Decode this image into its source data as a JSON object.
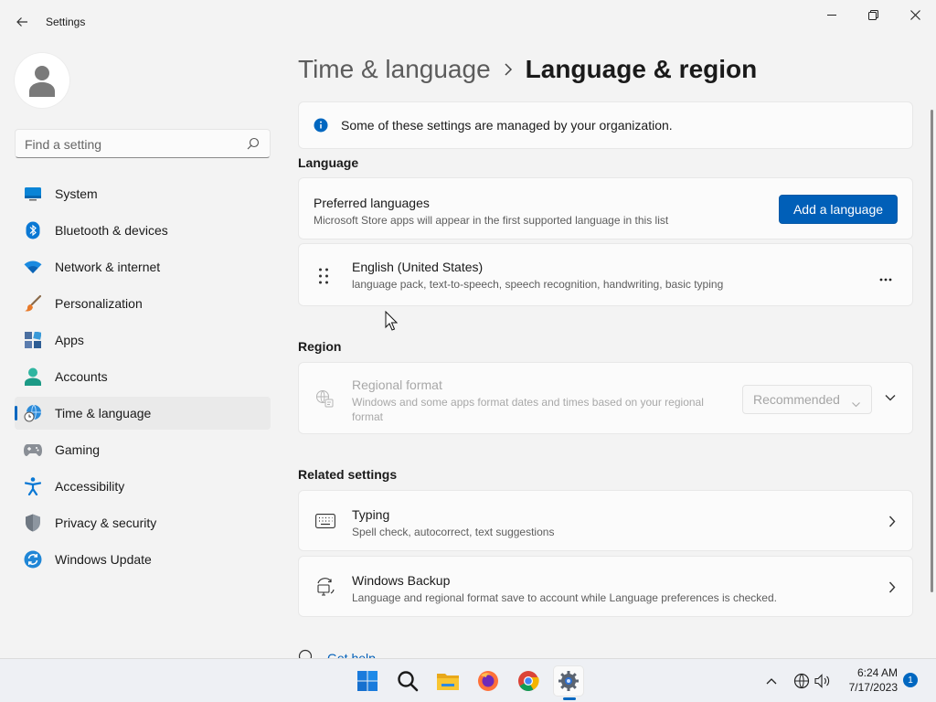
{
  "window": {
    "app_title": "Settings"
  },
  "search": {
    "placeholder": "Find a setting"
  },
  "sidebar": {
    "items": [
      {
        "label": "System",
        "icon": "system-icon"
      },
      {
        "label": "Bluetooth & devices",
        "icon": "bluetooth-icon"
      },
      {
        "label": "Network & internet",
        "icon": "wifi-icon"
      },
      {
        "label": "Personalization",
        "icon": "brush-icon"
      },
      {
        "label": "Apps",
        "icon": "apps-icon"
      },
      {
        "label": "Accounts",
        "icon": "accounts-icon"
      },
      {
        "label": "Time & language",
        "icon": "globe-clock-icon",
        "selected": true
      },
      {
        "label": "Gaming",
        "icon": "gamepad-icon"
      },
      {
        "label": "Accessibility",
        "icon": "accessibility-icon"
      },
      {
        "label": "Privacy & security",
        "icon": "shield-icon"
      },
      {
        "label": "Windows Update",
        "icon": "update-icon"
      }
    ]
  },
  "breadcrumb": {
    "parent": "Time & language",
    "current": "Language & region"
  },
  "info_banner": {
    "text": "Some of these settings are managed by your organization."
  },
  "language": {
    "heading": "Language",
    "preferred": {
      "title": "Preferred languages",
      "subtitle": "Microsoft Store apps will appear in the first supported language in this list",
      "add_button": "Add a language"
    },
    "entries": [
      {
        "title": "English (United States)",
        "subtitle": "language pack, text-to-speech, speech recognition, handwriting, basic typing"
      }
    ]
  },
  "region": {
    "heading": "Region",
    "regional_format": {
      "title": "Regional format",
      "subtitle_line1": "Windows and some apps format dates and times based on your regional",
      "subtitle_line2": "format",
      "dropdown_value": "Recommended"
    }
  },
  "related": {
    "heading": "Related settings",
    "items": [
      {
        "title": "Typing",
        "subtitle": "Spell check, autocorrect, text suggestions",
        "icon": "keyboard-icon"
      },
      {
        "title": "Windows Backup",
        "subtitle": "Language and regional format save to account while Language preferences is checked.",
        "icon": "backup-sync-icon"
      }
    ]
  },
  "footer": {
    "get_help": "Get help"
  },
  "taskbar": {
    "apps": [
      "windows-start-icon",
      "search-icon",
      "file-explorer-icon",
      "firefox-icon",
      "chrome-icon",
      "settings-gear-icon"
    ],
    "time": "6:24 AM",
    "date": "7/17/2023",
    "notification_count": "1"
  },
  "colors": {
    "accent": "#005fb8",
    "window_bg": "#f3f3f3",
    "card_bg": "#fbfbfb"
  }
}
